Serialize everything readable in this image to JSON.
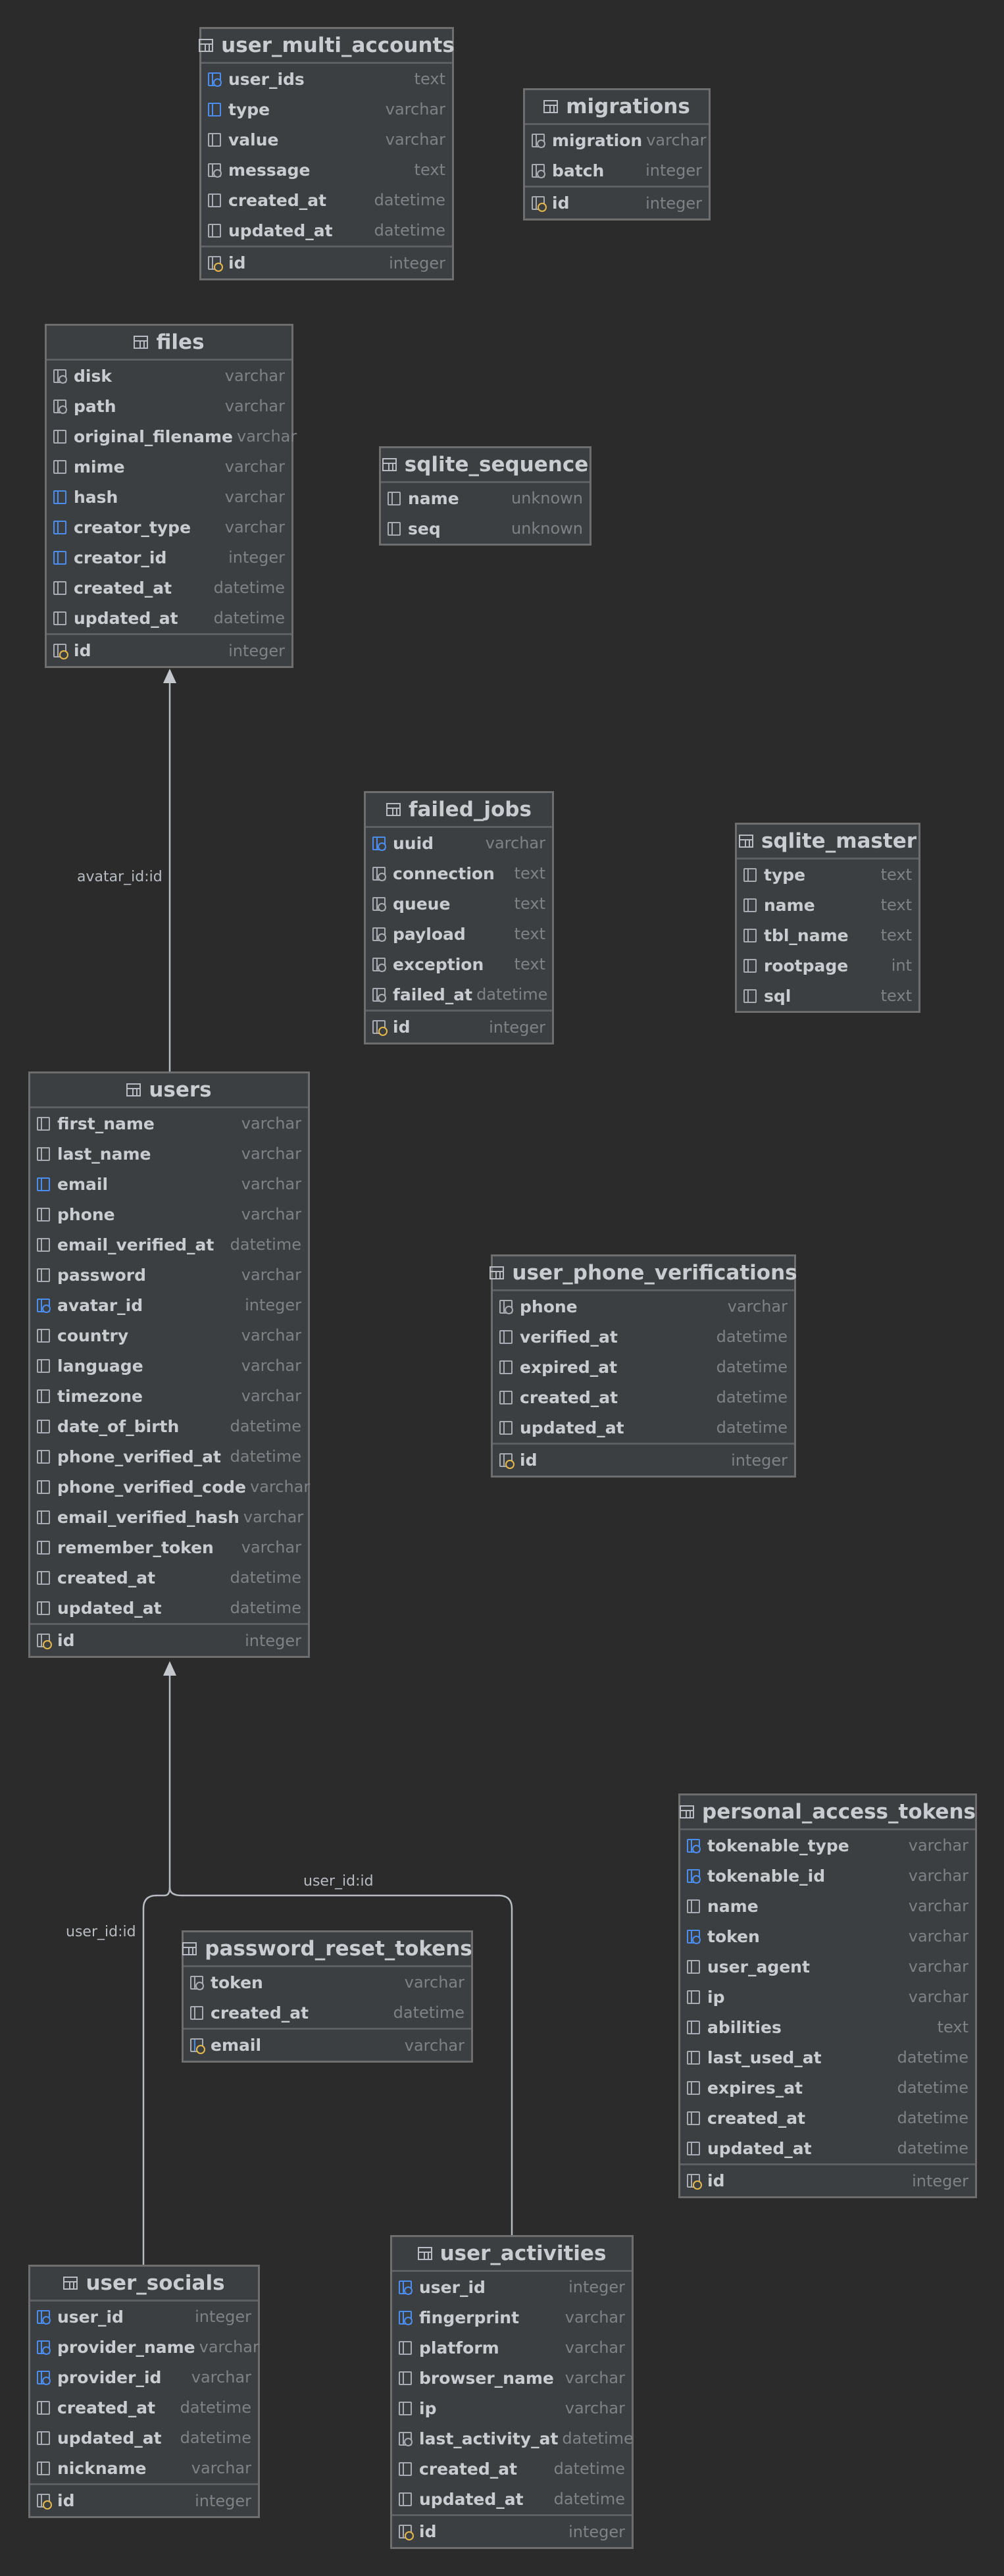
{
  "tables": [
    {
      "name": "user_multi_accounts",
      "fields": [
        {
          "name": "user_ids",
          "type": "text",
          "icon": "fk-index"
        },
        {
          "name": "type",
          "type": "varchar",
          "icon": "index"
        },
        {
          "name": "value",
          "type": "varchar",
          "icon": "column"
        },
        {
          "name": "message",
          "type": "text",
          "icon": "fk"
        },
        {
          "name": "created_at",
          "type": "datetime",
          "icon": "column"
        },
        {
          "name": "updated_at",
          "type": "datetime",
          "icon": "column"
        }
      ],
      "pk": {
        "name": "id",
        "type": "integer"
      }
    },
    {
      "name": "migrations",
      "fields": [
        {
          "name": "migration",
          "type": "varchar",
          "icon": "fk"
        },
        {
          "name": "batch",
          "type": "integer",
          "icon": "fk"
        }
      ],
      "pk": {
        "name": "id",
        "type": "integer"
      }
    },
    {
      "name": "files",
      "fields": [
        {
          "name": "disk",
          "type": "varchar",
          "icon": "fk"
        },
        {
          "name": "path",
          "type": "varchar",
          "icon": "fk"
        },
        {
          "name": "original_filename",
          "type": "varchar",
          "icon": "column"
        },
        {
          "name": "mime",
          "type": "varchar",
          "icon": "column"
        },
        {
          "name": "hash",
          "type": "varchar",
          "icon": "index"
        },
        {
          "name": "creator_type",
          "type": "varchar",
          "icon": "index"
        },
        {
          "name": "creator_id",
          "type": "integer",
          "icon": "index"
        },
        {
          "name": "created_at",
          "type": "datetime",
          "icon": "column"
        },
        {
          "name": "updated_at",
          "type": "datetime",
          "icon": "column"
        }
      ],
      "pk": {
        "name": "id",
        "type": "integer"
      }
    },
    {
      "name": "sqlite_sequence",
      "fields": [
        {
          "name": "name",
          "type": "unknown",
          "icon": "column"
        },
        {
          "name": "seq",
          "type": "unknown",
          "icon": "column"
        }
      ],
      "pk": null
    },
    {
      "name": "failed_jobs",
      "fields": [
        {
          "name": "uuid",
          "type": "varchar",
          "icon": "fk-index"
        },
        {
          "name": "connection",
          "type": "text",
          "icon": "fk"
        },
        {
          "name": "queue",
          "type": "text",
          "icon": "fk"
        },
        {
          "name": "payload",
          "type": "text",
          "icon": "fk"
        },
        {
          "name": "exception",
          "type": "text",
          "icon": "fk"
        },
        {
          "name": "failed_at",
          "type": "datetime",
          "icon": "fk"
        }
      ],
      "pk": {
        "name": "id",
        "type": "integer"
      }
    },
    {
      "name": "sqlite_master",
      "fields": [
        {
          "name": "type",
          "type": "text",
          "icon": "column"
        },
        {
          "name": "name",
          "type": "text",
          "icon": "column"
        },
        {
          "name": "tbl_name",
          "type": "text",
          "icon": "column"
        },
        {
          "name": "rootpage",
          "type": "int",
          "icon": "column"
        },
        {
          "name": "sql",
          "type": "text",
          "icon": "column"
        }
      ],
      "pk": null
    },
    {
      "name": "users",
      "fields": [
        {
          "name": "first_name",
          "type": "varchar",
          "icon": "column"
        },
        {
          "name": "last_name",
          "type": "varchar",
          "icon": "column"
        },
        {
          "name": "email",
          "type": "varchar",
          "icon": "index"
        },
        {
          "name": "phone",
          "type": "varchar",
          "icon": "column"
        },
        {
          "name": "email_verified_at",
          "type": "datetime",
          "icon": "column"
        },
        {
          "name": "password",
          "type": "varchar",
          "icon": "column"
        },
        {
          "name": "avatar_id",
          "type": "integer",
          "icon": "fk-index"
        },
        {
          "name": "country",
          "type": "varchar",
          "icon": "column"
        },
        {
          "name": "language",
          "type": "varchar",
          "icon": "column"
        },
        {
          "name": "timezone",
          "type": "varchar",
          "icon": "column"
        },
        {
          "name": "date_of_birth",
          "type": "datetime",
          "icon": "column"
        },
        {
          "name": "phone_verified_at",
          "type": "datetime",
          "icon": "column"
        },
        {
          "name": "phone_verified_code",
          "type": "varchar",
          "icon": "column"
        },
        {
          "name": "email_verified_hash",
          "type": "varchar",
          "icon": "column"
        },
        {
          "name": "remember_token",
          "type": "varchar",
          "icon": "column"
        },
        {
          "name": "created_at",
          "type": "datetime",
          "icon": "column"
        },
        {
          "name": "updated_at",
          "type": "datetime",
          "icon": "column"
        }
      ],
      "pk": {
        "name": "id",
        "type": "integer"
      }
    },
    {
      "name": "user_phone_verifications",
      "fields": [
        {
          "name": "phone",
          "type": "varchar",
          "icon": "fk"
        },
        {
          "name": "verified_at",
          "type": "datetime",
          "icon": "column"
        },
        {
          "name": "expired_at",
          "type": "datetime",
          "icon": "column"
        },
        {
          "name": "created_at",
          "type": "datetime",
          "icon": "column"
        },
        {
          "name": "updated_at",
          "type": "datetime",
          "icon": "column"
        }
      ],
      "pk": {
        "name": "id",
        "type": "integer"
      }
    },
    {
      "name": "personal_access_tokens",
      "fields": [
        {
          "name": "tokenable_type",
          "type": "varchar",
          "icon": "fk-index"
        },
        {
          "name": "tokenable_id",
          "type": "varchar",
          "icon": "fk-index"
        },
        {
          "name": "name",
          "type": "varchar",
          "icon": "column"
        },
        {
          "name": "token",
          "type": "varchar",
          "icon": "fk-index"
        },
        {
          "name": "user_agent",
          "type": "varchar",
          "icon": "column"
        },
        {
          "name": "ip",
          "type": "varchar",
          "icon": "column"
        },
        {
          "name": "abilities",
          "type": "text",
          "icon": "column"
        },
        {
          "name": "last_used_at",
          "type": "datetime",
          "icon": "column"
        },
        {
          "name": "expires_at",
          "type": "datetime",
          "icon": "column"
        },
        {
          "name": "created_at",
          "type": "datetime",
          "icon": "column"
        },
        {
          "name": "updated_at",
          "type": "datetime",
          "icon": "column"
        }
      ],
      "pk": {
        "name": "id",
        "type": "integer"
      }
    },
    {
      "name": "password_reset_tokens",
      "fields": [
        {
          "name": "token",
          "type": "varchar",
          "icon": "fk"
        },
        {
          "name": "created_at",
          "type": "datetime",
          "icon": "column"
        }
      ],
      "pk": {
        "name": "email",
        "type": "varchar",
        "pk_icon": "pk-index"
      }
    },
    {
      "name": "user_socials",
      "fields": [
        {
          "name": "user_id",
          "type": "integer",
          "icon": "fk-index"
        },
        {
          "name": "provider_name",
          "type": "varchar",
          "icon": "fk-index"
        },
        {
          "name": "provider_id",
          "type": "varchar",
          "icon": "fk-index"
        },
        {
          "name": "created_at",
          "type": "datetime",
          "icon": "column"
        },
        {
          "name": "updated_at",
          "type": "datetime",
          "icon": "column"
        },
        {
          "name": "nickname",
          "type": "varchar",
          "icon": "column"
        }
      ],
      "pk": {
        "name": "id",
        "type": "integer"
      }
    },
    {
      "name": "user_activities",
      "fields": [
        {
          "name": "user_id",
          "type": "integer",
          "icon": "fk-index"
        },
        {
          "name": "fingerprint",
          "type": "varchar",
          "icon": "fk-index"
        },
        {
          "name": "platform",
          "type": "varchar",
          "icon": "column"
        },
        {
          "name": "browser_name",
          "type": "varchar",
          "icon": "column"
        },
        {
          "name": "ip",
          "type": "varchar",
          "icon": "column"
        },
        {
          "name": "last_activity_at",
          "type": "datetime",
          "icon": "fk"
        },
        {
          "name": "created_at",
          "type": "datetime",
          "icon": "column"
        },
        {
          "name": "updated_at",
          "type": "datetime",
          "icon": "column"
        }
      ],
      "pk": {
        "name": "id",
        "type": "integer"
      }
    }
  ],
  "relations": [
    {
      "label": "avatar_id:id",
      "from": "users",
      "to": "files"
    },
    {
      "label": "user_id:id",
      "from": "user_socials",
      "to": "users"
    },
    {
      "label": "user_id:id",
      "from": "user_activities",
      "to": "users"
    }
  ],
  "colors": {
    "background": "#2b2b2b",
    "table": "#3c3f41",
    "border": "#6e6e6e",
    "index_icon": "#4c8ef0",
    "pk_icon": "#e7b94b"
  }
}
